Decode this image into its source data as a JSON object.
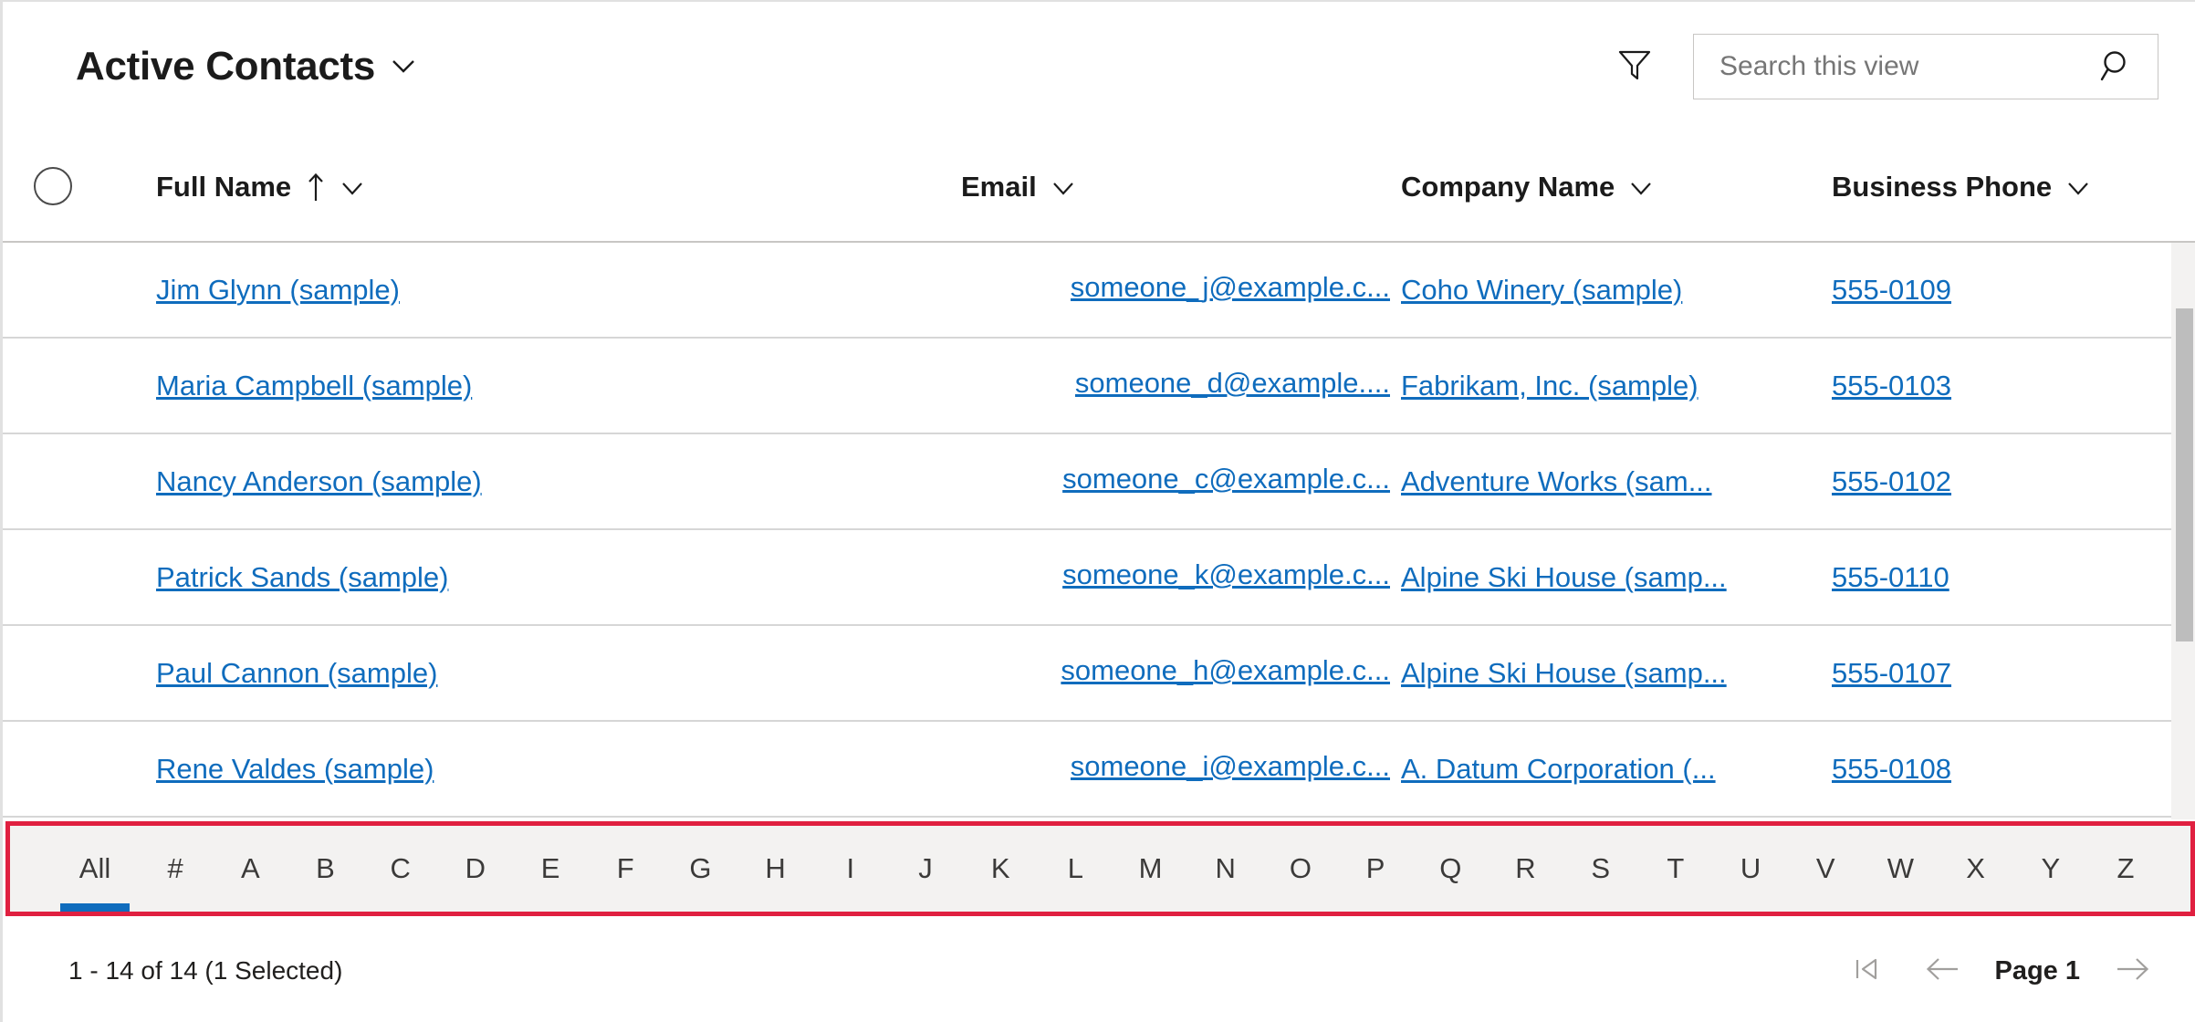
{
  "header": {
    "view_title": "Active Contacts",
    "view_chevron_icon": "chevron-down-icon",
    "filter_icon": "filter-funnel-icon",
    "search": {
      "placeholder": "Search this view",
      "value": "",
      "icon": "search-icon"
    }
  },
  "grid": {
    "select_all_icon": "radio-unchecked-icon",
    "columns": [
      {
        "label": "Full Name",
        "sorted": "ascending",
        "sort_icon": "arrow-up-icon",
        "menu_icon": "chevron-down-icon"
      },
      {
        "label": "Email",
        "sorted": "",
        "sort_icon": "",
        "menu_icon": "chevron-down-icon"
      },
      {
        "label": "Company Name",
        "sorted": "",
        "sort_icon": "",
        "menu_icon": "chevron-down-icon"
      },
      {
        "label": "Business Phone",
        "sorted": "",
        "sort_icon": "",
        "menu_icon": "chevron-down-icon"
      }
    ],
    "rows": [
      {
        "full_name": "Jim Glynn (sample)",
        "email": "someone_j@example.c...",
        "company": "Coho Winery (sample)",
        "phone": "555-0109"
      },
      {
        "full_name": "Maria Campbell (sample)",
        "email": "someone_d@example....",
        "company": "Fabrikam, Inc. (sample)",
        "phone": "555-0103"
      },
      {
        "full_name": "Nancy Anderson (sample)",
        "email": "someone_c@example.c...",
        "company": "Adventure Works (sam...",
        "phone": "555-0102"
      },
      {
        "full_name": "Patrick Sands (sample)",
        "email": "someone_k@example.c...",
        "company": "Alpine Ski House (samp...",
        "phone": "555-0110"
      },
      {
        "full_name": "Paul Cannon (sample)",
        "email": "someone_h@example.c...",
        "company": "Alpine Ski House (samp...",
        "phone": "555-0107"
      },
      {
        "full_name": "Rene Valdes (sample)",
        "email": "someone_i@example.c...",
        "company": "A. Datum Corporation (...",
        "phone": "555-0108"
      }
    ],
    "scrollbar": {
      "name": "vertical-scrollbar"
    }
  },
  "alphabet_filter": {
    "highlight_color": "#e02040",
    "selected_indicator_color": "#0f6cbd",
    "selected": "All",
    "items": [
      "All",
      "#",
      "A",
      "B",
      "C",
      "D",
      "E",
      "F",
      "G",
      "H",
      "I",
      "J",
      "K",
      "L",
      "M",
      "N",
      "O",
      "P",
      "Q",
      "R",
      "S",
      "T",
      "U",
      "V",
      "W",
      "X",
      "Y",
      "Z"
    ]
  },
  "footer": {
    "record_count": "1 - 14 of 14 (1 Selected)",
    "pager": {
      "first_page_icon": "first-page-icon",
      "previous_page_icon": "arrow-left-icon",
      "page_label": "Page 1",
      "next_page_icon": "arrow-right-icon"
    }
  },
  "colors": {
    "link": "#0f6cbd",
    "accent": "#0f6cbd",
    "highlight_border": "#e02040",
    "row_divider": "#d6d6d6",
    "alpha_bar_bg": "#f3f2f1"
  }
}
